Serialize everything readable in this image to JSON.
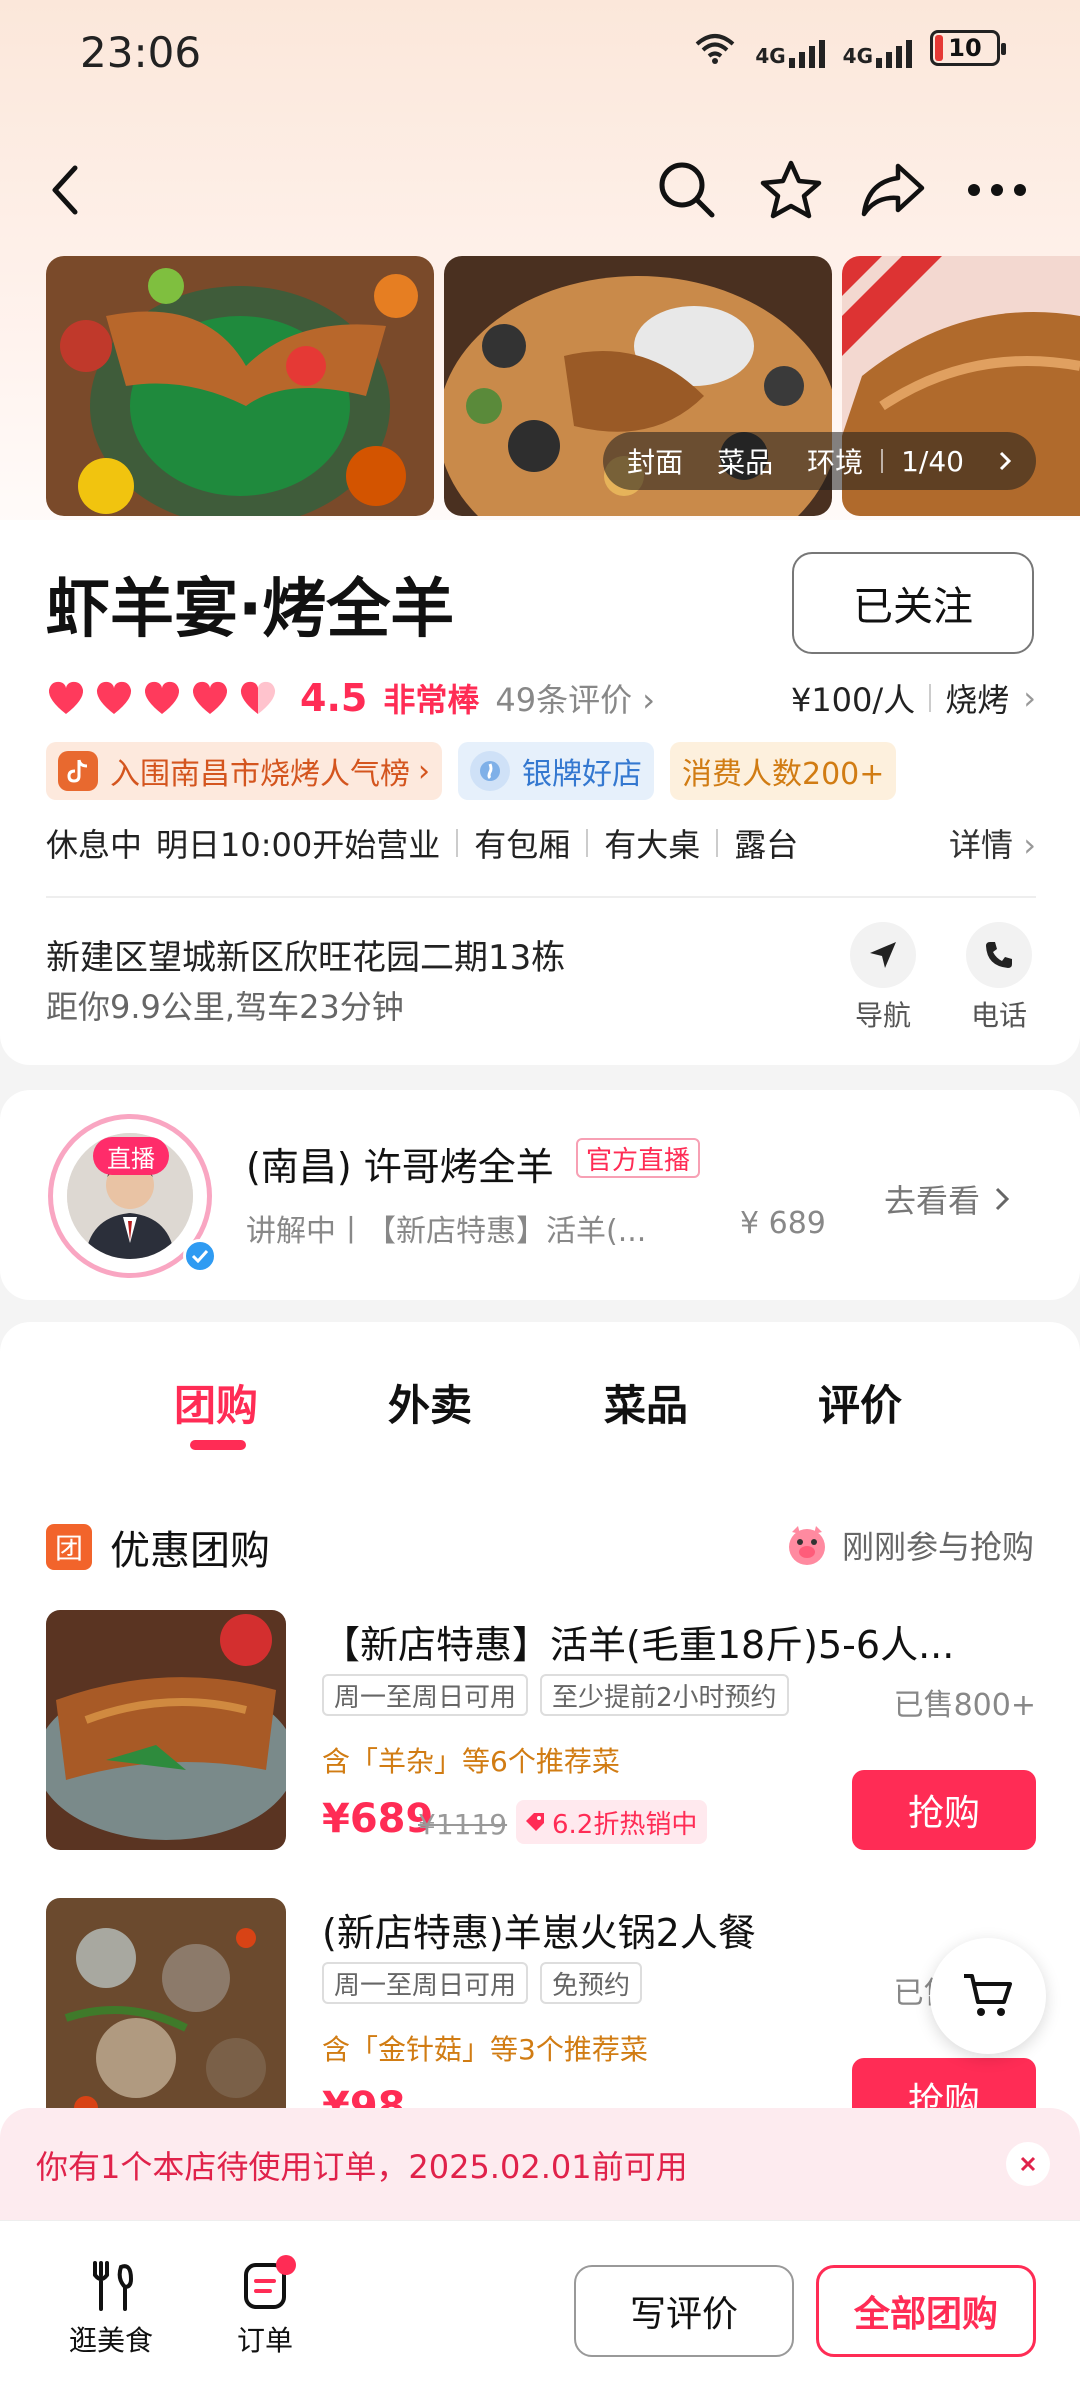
{
  "status": {
    "time": "23:06",
    "net1": "4G",
    "net2": "4G",
    "battery": "10"
  },
  "gallery": {
    "tabs": [
      "封面",
      "菜品",
      "环境"
    ],
    "counter": "1/40"
  },
  "store": {
    "name": "虾羊宴·烤全羊",
    "follow_label": "已关注",
    "score": "4.5",
    "score_label": "非常棒",
    "reviews": "49条评价",
    "reviews_arrow": "›",
    "price_per": "¥100/人",
    "category": "烧烤",
    "category_arrow": "›",
    "badges": {
      "rank": "入围南昌市烧烤人气榜",
      "rank_arrow": "›",
      "silver": "银牌好店",
      "count": "消费人数200+"
    },
    "hours": {
      "status": "休息中",
      "open": "明日10:00开始营业",
      "features": [
        "有包厢",
        "有大桌",
        "露台"
      ],
      "detail": "详情",
      "detail_arrow": "›"
    },
    "address": "新建区望城新区欣旺花园二期13栋",
    "distance": "距你9.9公里,驾车23分钟",
    "actions": {
      "nav": "导航",
      "phone": "电话"
    }
  },
  "live": {
    "tag": "直播",
    "name": "(南昌) 许哥烤全羊",
    "official": "官方直播",
    "sub": "讲解中丨【新店特惠】活羊(...",
    "price": "¥ 689",
    "go": "去看看"
  },
  "tabs": [
    "团购",
    "外卖",
    "菜品",
    "评价"
  ],
  "section": {
    "icon_text": "团",
    "title": "优惠团购",
    "right": "刚刚参与抢购"
  },
  "deals": [
    {
      "title": "【新店特惠】活羊(毛重18斤)5-6人...",
      "tags": [
        "周一至周日可用",
        "至少提前2小时预约"
      ],
      "sold": "已售800+",
      "includes": "含「羊杂」等6个推荐菜",
      "price": "¥689",
      "orig": "¥1119",
      "discount": "6.2折热销中",
      "buy": "抢购"
    },
    {
      "title": "(新店特惠)羊崽火锅2人餐",
      "tags": [
        "周一至周日可用",
        "免预约"
      ],
      "sold": "已售200+",
      "includes": "含「金针菇」等3个推荐菜",
      "price": "¥98",
      "orig": "",
      "discount": "",
      "buy": "抢购"
    }
  ],
  "notice": "你有1个本店待使用订单，2025.02.01前可用",
  "bottom": {
    "food": "逛美食",
    "order": "订单",
    "review": "写评价",
    "all": "全部团购"
  },
  "colors": {
    "accent": "#ff2c55",
    "orange": "#d17c13",
    "blue": "#3478d0"
  },
  "icons": [
    "back-icon",
    "search-icon",
    "star-icon",
    "share-icon",
    "more-icon",
    "navigate-icon",
    "phone-icon",
    "cart-icon",
    "close-icon",
    "fork-knife-icon",
    "order-icon"
  ]
}
